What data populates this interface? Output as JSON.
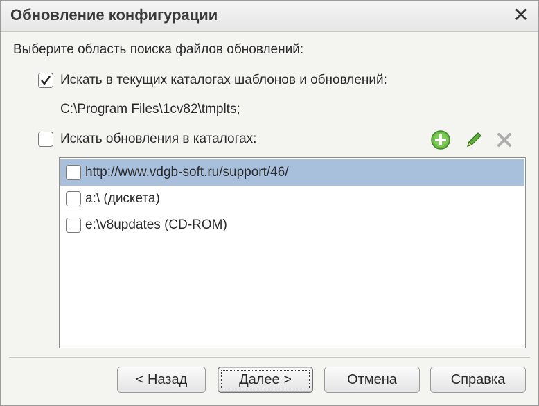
{
  "dialog": {
    "title": "Обновление конфигурации",
    "close_glyph": "✕"
  },
  "prompt": "Выберите область поиска файлов обновлений:",
  "option_current": {
    "label": "Искать в текущих каталогах шаблонов и обновлений:",
    "checked": true,
    "path": "C:\\Program Files\\1cv82\\tmplts;"
  },
  "option_catalogs": {
    "label": "Искать обновления в каталогах:",
    "checked": false
  },
  "toolbar": {
    "add_icon": "add-icon",
    "edit_icon": "pencil-icon",
    "delete_icon": "delete-icon",
    "add_color": "#5aa83a",
    "edit_color": "#4a9a2a",
    "delete_color": "#b0b0b0"
  },
  "catalogs": [
    {
      "label": "http://www.vdgb-soft.ru/support/46/",
      "checked": false,
      "selected": true
    },
    {
      "label": "a:\\ (дискета)",
      "checked": false,
      "selected": false
    },
    {
      "label": "e:\\v8updates (CD-ROM)",
      "checked": false,
      "selected": false
    }
  ],
  "buttons": {
    "back": "< Назад",
    "next": "Далее >",
    "cancel": "Отмена",
    "help": "Справка"
  },
  "colors": {
    "selection": "#a9c0dd"
  }
}
